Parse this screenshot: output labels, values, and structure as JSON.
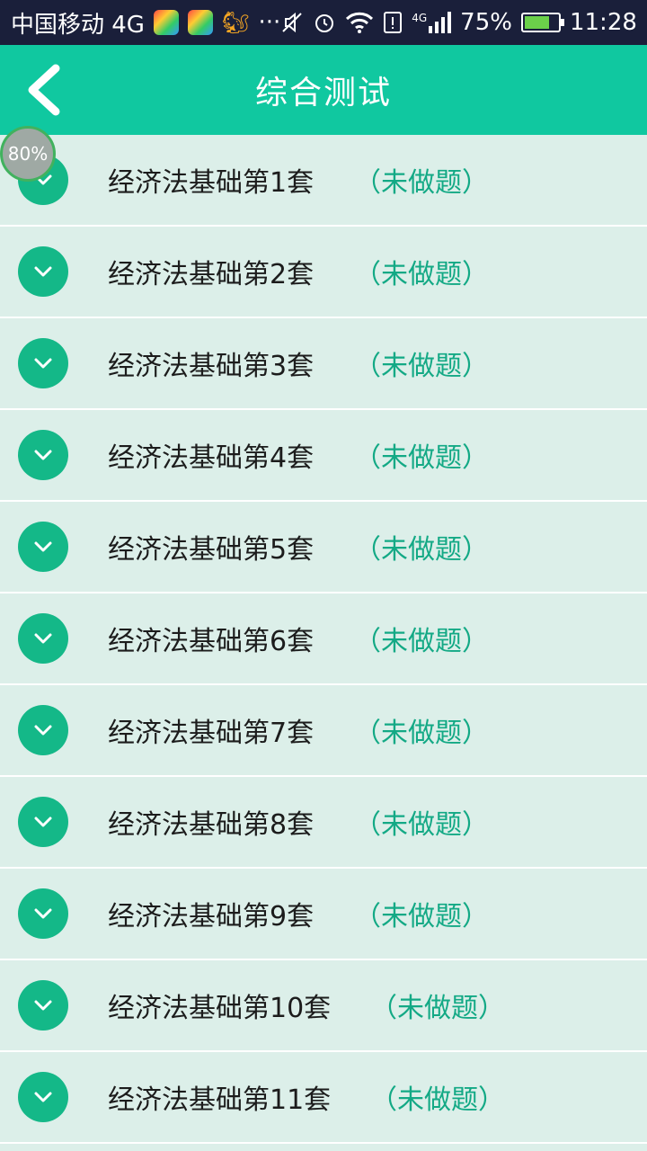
{
  "status_bar": {
    "carrier": "中国移动 4G",
    "more": "···",
    "network": "4G",
    "battery": "75%",
    "battery_level": 0.75,
    "time": "11:28"
  },
  "header": {
    "title": "综合测试"
  },
  "badge": {
    "text": "80%"
  },
  "list": {
    "items": [
      {
        "title": "经济法基础第1套",
        "status": "（未做题）"
      },
      {
        "title": "经济法基础第2套",
        "status": "（未做题）"
      },
      {
        "title": "经济法基础第3套",
        "status": "（未做题）"
      },
      {
        "title": "经济法基础第4套",
        "status": "（未做题）"
      },
      {
        "title": "经济法基础第5套",
        "status": "（未做题）"
      },
      {
        "title": "经济法基础第6套",
        "status": "（未做题）"
      },
      {
        "title": "经济法基础第7套",
        "status": "（未做题）"
      },
      {
        "title": "经济法基础第8套",
        "status": "（未做题）"
      },
      {
        "title": "经济法基础第9套",
        "status": "（未做题）"
      },
      {
        "title": "经济法基础第10套",
        "status": "（未做题）"
      },
      {
        "title": "经济法基础第11套",
        "status": "（未做题）"
      }
    ]
  },
  "colors": {
    "accent": "#10c8a0",
    "chevron_circle": "#14b888",
    "status_text": "#13a985"
  }
}
